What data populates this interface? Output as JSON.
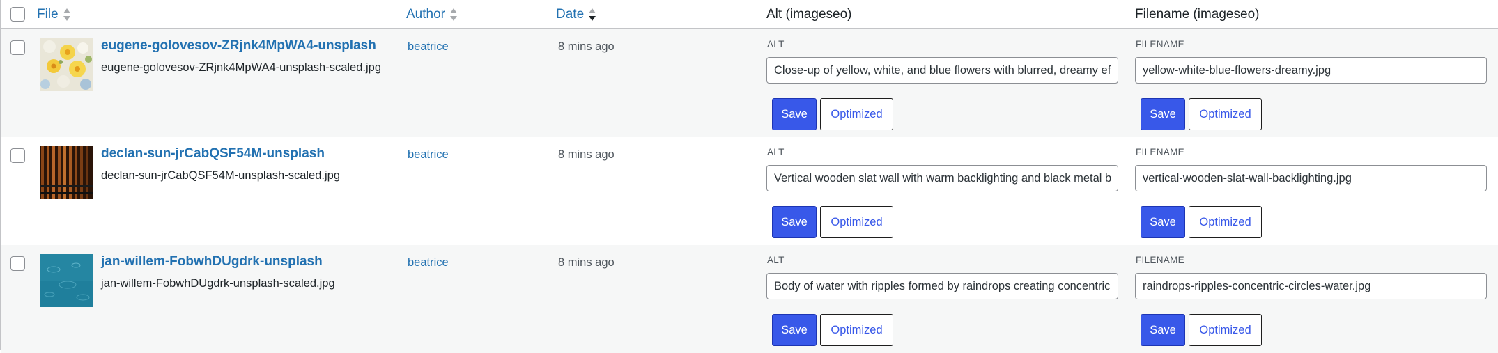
{
  "columns": {
    "file": "File",
    "author": "Author",
    "date": "Date",
    "alt": "Alt (imageseo)",
    "filename": "Filename (imageseo)"
  },
  "accent_color": "#3858e9",
  "link_color": "#2271b1",
  "rows": [
    {
      "title": "eugene-golovesov-ZRjnk4MpWA4-unsplash",
      "file": "eugene-golovesov-ZRjnk4MpWA4-unsplash-scaled.jpg",
      "author": "beatrice",
      "date": "8 mins ago",
      "alt_label": "ALT",
      "alt_value": "Close-up of yellow, white, and blue flowers with blurred, dreamy eff",
      "filename_label": "FILENAME",
      "filename_value": "yellow-white-blue-flowers-dreamy.jpg",
      "save_label": "Save",
      "optimized_label": "Optimized",
      "thumb_icon": "flowers-thumbnail"
    },
    {
      "title": "declan-sun-jrCabQSF54M-unsplash",
      "file": "declan-sun-jrCabQSF54M-unsplash-scaled.jpg",
      "author": "beatrice",
      "date": "8 mins ago",
      "alt_label": "ALT",
      "alt_value": "Vertical wooden slat wall with warm backlighting and black metal ba",
      "filename_label": "FILENAME",
      "filename_value": "vertical-wooden-slat-wall-backlighting.jpg",
      "save_label": "Save",
      "optimized_label": "Optimized",
      "thumb_icon": "wooden-slats-thumbnail"
    },
    {
      "title": "jan-willem-FobwhDUgdrk-unsplash",
      "file": "jan-willem-FobwhDUgdrk-unsplash-scaled.jpg",
      "author": "beatrice",
      "date": "8 mins ago",
      "alt_label": "ALT",
      "alt_value": "Body of water with ripples formed by raindrops creating concentric",
      "filename_label": "FILENAME",
      "filename_value": "raindrops-ripples-concentric-circles-water.jpg",
      "save_label": "Save",
      "optimized_label": "Optimized",
      "thumb_icon": "water-ripples-thumbnail"
    }
  ]
}
